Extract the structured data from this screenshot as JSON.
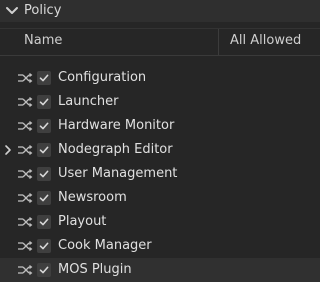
{
  "section": {
    "title": "Policy",
    "expanded": true
  },
  "columns": {
    "name": "Name",
    "all_allowed": "All Allowed"
  },
  "items": [
    {
      "label": "Configuration",
      "checked": true,
      "expandable": false
    },
    {
      "label": "Launcher",
      "checked": true,
      "expandable": false
    },
    {
      "label": "Hardware Monitor",
      "checked": true,
      "expandable": false
    },
    {
      "label": "Nodegraph Editor",
      "checked": true,
      "expandable": true
    },
    {
      "label": "User Management",
      "checked": true,
      "expandable": false
    },
    {
      "label": "Newsroom",
      "checked": true,
      "expandable": false
    },
    {
      "label": "Playout",
      "checked": true,
      "expandable": false
    },
    {
      "label": "Cook Manager",
      "checked": true,
      "expandable": false
    },
    {
      "label": "MOS Plugin",
      "checked": true,
      "expandable": false,
      "hovered": true
    }
  ],
  "colors": {
    "background": "#262626",
    "header": "#2f2f2f",
    "text": "#e0e0e0",
    "checkbox": "#3f3f3f",
    "icon": "#bdbdbd"
  },
  "icons": {
    "section_toggle": "chevron-down-icon",
    "row_action": "shuffle-icon",
    "row_expand": "chevron-right-icon",
    "checkbox": "check-icon"
  }
}
